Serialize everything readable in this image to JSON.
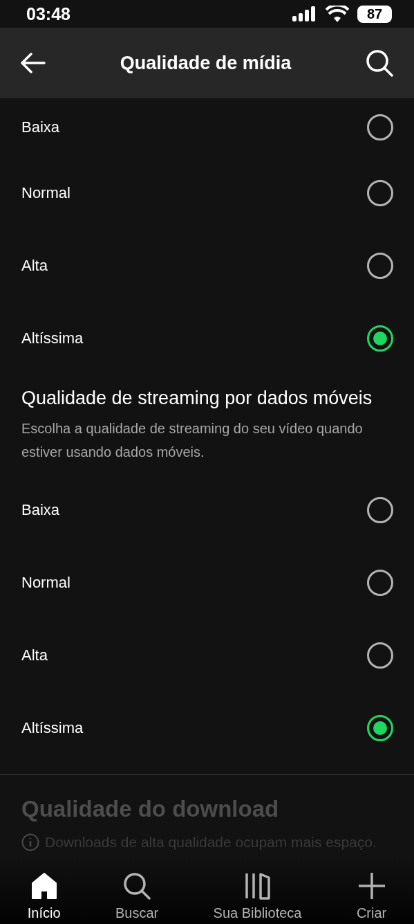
{
  "status_bar": {
    "time": "03:48",
    "battery": "87"
  },
  "header": {
    "title": "Qualidade de mídia"
  },
  "wifi_options": [
    {
      "label": "Baixa",
      "selected": false
    },
    {
      "label": "Normal",
      "selected": false
    },
    {
      "label": "Alta",
      "selected": false
    },
    {
      "label": "Altíssima",
      "selected": true
    }
  ],
  "mobile_section": {
    "title": "Qualidade de streaming por dados móveis",
    "description": "Escolha a qualidade de streaming do seu vídeo quando estiver usando dados móveis.",
    "options": [
      {
        "label": "Baixa",
        "selected": false
      },
      {
        "label": "Normal",
        "selected": false
      },
      {
        "label": "Alta",
        "selected": false
      },
      {
        "label": "Altíssima",
        "selected": true
      }
    ]
  },
  "download_section": {
    "title": "Qualidade do download",
    "info": "Downloads de alta qualidade ocupam mais espaço."
  },
  "bottom_nav": [
    {
      "label": "Início",
      "kind": "home",
      "selected": true
    },
    {
      "label": "Buscar",
      "kind": "search",
      "selected": false
    },
    {
      "label": "Sua Biblioteca",
      "kind": "library",
      "selected": false
    },
    {
      "label": "Criar",
      "kind": "create",
      "selected": false
    }
  ]
}
